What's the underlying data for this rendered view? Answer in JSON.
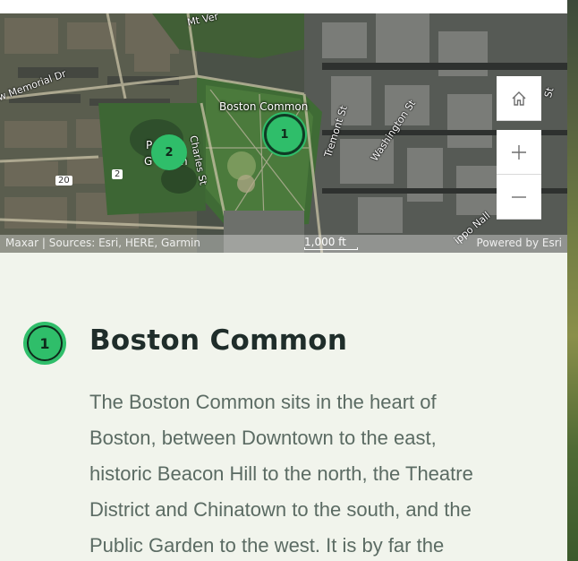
{
  "map": {
    "place_labels": {
      "boston_common": "Boston Common",
      "public_garden_partial_a": "P",
      "public_garden_partial_b": "G",
      "public_garden_partial_c": "n"
    },
    "street_labels": {
      "memorial_dr": "w Memorial Dr",
      "charles_st": "Charles St",
      "tremont_st": "Tremont St",
      "washington_st": "Washington St",
      "top_partial": "Mt Ver",
      "right_partial": "St",
      "bottom_partial": "ippo Nall",
      "shield_20": "20",
      "shield_2": "2"
    },
    "markers": [
      {
        "label": "1",
        "active": true
      },
      {
        "label": "2",
        "active": false
      }
    ],
    "controls": {
      "home_icon": "home-icon",
      "zoom_in_icon": "plus-icon",
      "zoom_out_icon": "minus-icon"
    },
    "attribution": {
      "sources": "Maxar | Sources: Esri, HERE, Garmin",
      "scale": "1,000 ft",
      "powered": "Powered by Esri"
    }
  },
  "entry": {
    "number": "1",
    "title": "Boston Common",
    "description_lines": [
      "The Boston Common sits in the heart of",
      "Boston, between Downtown to the east,",
      "historic Beacon Hill  to the north, the Theatre",
      "District and Chinatown to the south, and the",
      "Public Garden to the west. It is by far the"
    ]
  },
  "colors": {
    "marker_green": "#2fbe6a",
    "panel_bg": "#f1f4ec",
    "title_text": "#1f2d2a",
    "body_text": "#5b6b63"
  }
}
